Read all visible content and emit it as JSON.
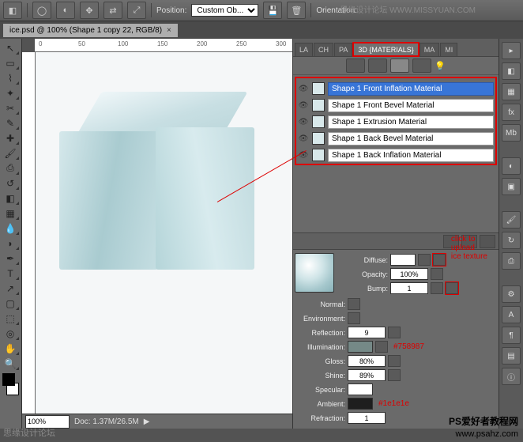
{
  "toolbar": {
    "position_label": "Position:",
    "position_value": "Custom Ob...",
    "orientation_label": "Orientation:"
  },
  "doc": {
    "title": "ice.psd @ 100% (Shape 1 copy 22, RGB/8)"
  },
  "rulers": {
    "marks": [
      "0",
      "50",
      "100",
      "150",
      "200",
      "250",
      "300"
    ]
  },
  "status": {
    "zoom": "100%",
    "doc": "Doc: 1.37M/26.5M"
  },
  "panel": {
    "tabs": [
      "LA",
      "CH",
      "PA",
      "3D {MATERIALS}",
      "MA",
      "MI"
    ],
    "active": 3
  },
  "materials": [
    {
      "name": "Shape 1 Front Inflation Material",
      "sel": true
    },
    {
      "name": "Shape 1 Front Bevel Material"
    },
    {
      "name": "Shape 1 Extrusion Material"
    },
    {
      "name": "Shape 1 Back Bevel Material"
    },
    {
      "name": "Shape 1 Back Inflation Material"
    }
  ],
  "props": {
    "diffuse": {
      "label": "Diffuse:",
      "color": "#ffffff"
    },
    "opacity": {
      "label": "Opacity:",
      "value": "100%"
    },
    "bump": {
      "label": "Bump:",
      "value": "1"
    },
    "normal": {
      "label": "Normal:"
    },
    "environment": {
      "label": "Environment:"
    },
    "reflection": {
      "label": "Reflection:",
      "value": "9"
    },
    "illumination": {
      "label": "Illumination:",
      "color": "#758987",
      "hex": "#758987"
    },
    "gloss": {
      "label": "Gloss:",
      "value": "80%"
    },
    "shine": {
      "label": "Shine:",
      "value": "89%"
    },
    "specular": {
      "label": "Specular:",
      "color": "#ffffff"
    },
    "ambient": {
      "label": "Ambient:",
      "color": "#1e1e1e",
      "hex": "#1e1e1e"
    },
    "refraction": {
      "label": "Refraction:",
      "value": "1"
    }
  },
  "notes": {
    "upload": "click to\nupload\nice texture"
  },
  "watermarks": {
    "top": "思缘设计论坛  WWW.MISSYUAN.COM",
    "bl": "思缘设计论坛",
    "br1": "PS爱好者教程网",
    "br2": "www.psahz.com"
  }
}
